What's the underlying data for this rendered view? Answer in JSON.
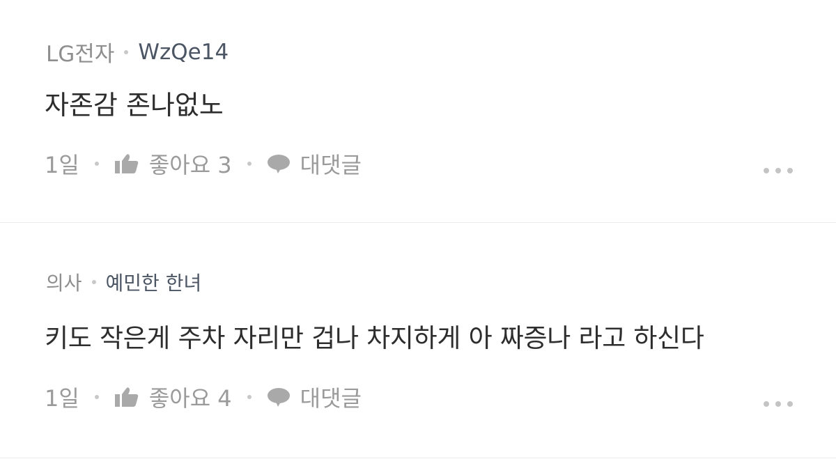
{
  "comments": [
    {
      "company": "LG전자",
      "author": "WzQe14",
      "text": "자존감 존나없노",
      "time": "1일",
      "like_label": "좋아요 3",
      "reply_label": "대댓글"
    },
    {
      "company": "의사",
      "author": "예민한 한녀",
      "text": "키도 작은게 주차 자리만 겁나 차지하게 아 짜증나 라고 하신다",
      "time": "1일",
      "like_label": "좋아요 4",
      "reply_label": "대댓글"
    }
  ],
  "icons": {
    "like": "thumbs-up-icon",
    "reply": "speech-bubble-icon",
    "more": "more-dots-icon"
  },
  "colors": {
    "meta_gray": "#8e8e8e",
    "author": "#4b5563",
    "body_text": "#2d2d2d",
    "action_gray": "#9a9a9a",
    "divider": "#ececec"
  }
}
